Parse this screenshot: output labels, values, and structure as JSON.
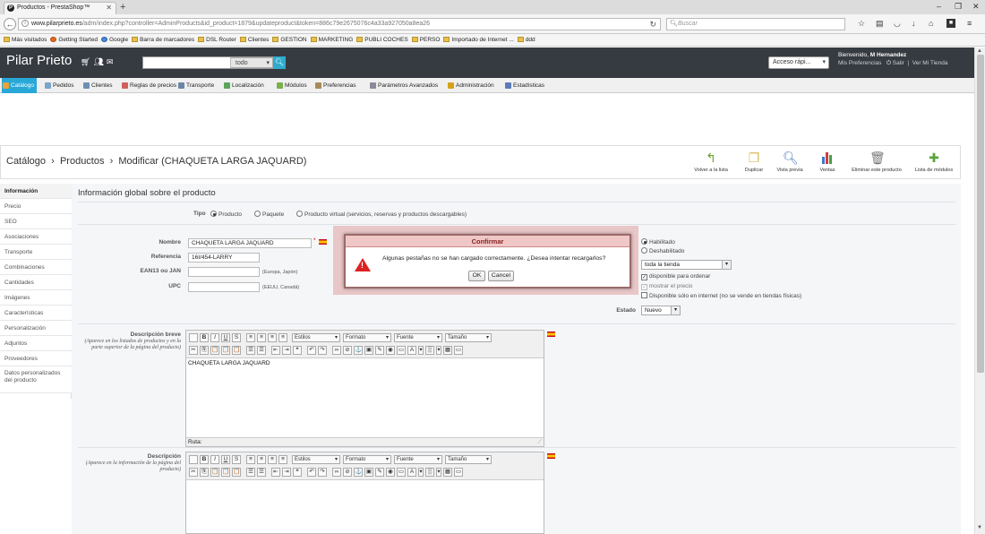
{
  "browser": {
    "tab_title": "Productos - PrestaShop™",
    "url_host": "www.pilarprieto.es",
    "url_path": "/adm/index.php?controller=AdminProducts&id_product=1879&updateproduct&token=886c79e2675076c4a33a927050a8ea26",
    "search_placeholder": "Buscar",
    "bookmarks": [
      "Más visitados",
      "Getting Started",
      "Google",
      "Barra de marcadores",
      "DSL Router",
      "Clientes",
      "GESTION",
      "MARKETING",
      "PUBLI COCHES",
      "PERSO",
      "Importado de Internet ...",
      "ddd"
    ]
  },
  "header": {
    "shop_name": "Pilar Prieto",
    "search_scope": "todo",
    "quick_access": "Acceso rápi...",
    "welcome_prefix": "Bienvenido,",
    "user_name": "M Hernandez",
    "links": [
      "Mis Preferencias",
      "Salir",
      "Ver Mi Tienda"
    ]
  },
  "menu": [
    {
      "label": "Catálogo",
      "color": "#e8a33a"
    },
    {
      "label": "Pedidos",
      "color": "#7aa5c9"
    },
    {
      "label": "Clientes",
      "color": "#6d8fb3"
    },
    {
      "label": "Reglas de precios",
      "color": "#d06060"
    },
    {
      "label": "Transporte",
      "color": "#6a86a5"
    },
    {
      "label": "Localización",
      "color": "#5aa45a"
    },
    {
      "label": "Módulos",
      "color": "#7ab04a"
    },
    {
      "label": "Preferencias",
      "color": "#a88b5a"
    },
    {
      "label": "Parámetros Avanzados",
      "color": "#8a8a9a"
    },
    {
      "label": "Administración",
      "color": "#d6a21a"
    },
    {
      "label": "Estadísticas",
      "color": "#5a7ab8"
    }
  ],
  "breadcrumb": {
    "root": "Catálogo",
    "section": "Productos",
    "page": "Modificar (CHAQUETA LARGA JAQUARD)"
  },
  "toolbar": [
    "Volver a la lista",
    "Duplicar",
    "Vista previa",
    "Ventas",
    "Eliminar este producto",
    "Lista de módulos"
  ],
  "left_tabs": [
    "Información",
    "Precio",
    "SEO",
    "Asociaciones",
    "Transporte",
    "Combinaciones",
    "Cantidades",
    "Imágenes",
    "Características",
    "Personalización",
    "Adjuntos",
    "Proveedores",
    "Datos personalizados del producto"
  ],
  "form": {
    "section_title": "Información global sobre el producto",
    "type_label": "Tipo",
    "type_options": [
      "Producto",
      "Paquete",
      "Producto virtual (servicios, reservas y productos descargables)"
    ],
    "name_label": "Nombre",
    "name_value": "CHAQUETA LARGA JAQUARD",
    "name_required": "*",
    "ref_label": "Referencia",
    "ref_value": "16I/454-LARRY",
    "ean_label": "EAN13 ou JAN",
    "ean_note": "(Europa, Japón)",
    "upc_label": "UPC",
    "upc_note": "(EEUU, Canadá)",
    "status_enabled": "Habilitado",
    "status_disabled": "Deshabilitado",
    "visibility_value": "toda la tienda",
    "opt_available": "disponible para ordenar",
    "opt_price": "mostrar el precio",
    "opt_online": "Disponible sólo en internet (no se vende en tiendas físicas)",
    "condition_label": "Estado",
    "condition_value": "Nuevo",
    "short_desc_label": "Descripción breve",
    "short_desc_help": "(Aparece en los listados de productos y en la parte superior de la página del producto)",
    "short_desc_value": "CHAQUETA LARGA JAQUARD",
    "path_label": "Ruta:",
    "desc_label": "Descripción",
    "desc_help": "(Aparece en la información de la página del producto)"
  },
  "editor": {
    "styles": "Estilos",
    "format": "Formato",
    "font": "Fuente",
    "size": "Tamaño"
  },
  "dialog": {
    "title": "Confirmar",
    "message": "Algunas pestañas no se han cargado correctamente. ¿Desea intentar recargarlos?",
    "ok": "OK",
    "cancel": "Cancel"
  }
}
